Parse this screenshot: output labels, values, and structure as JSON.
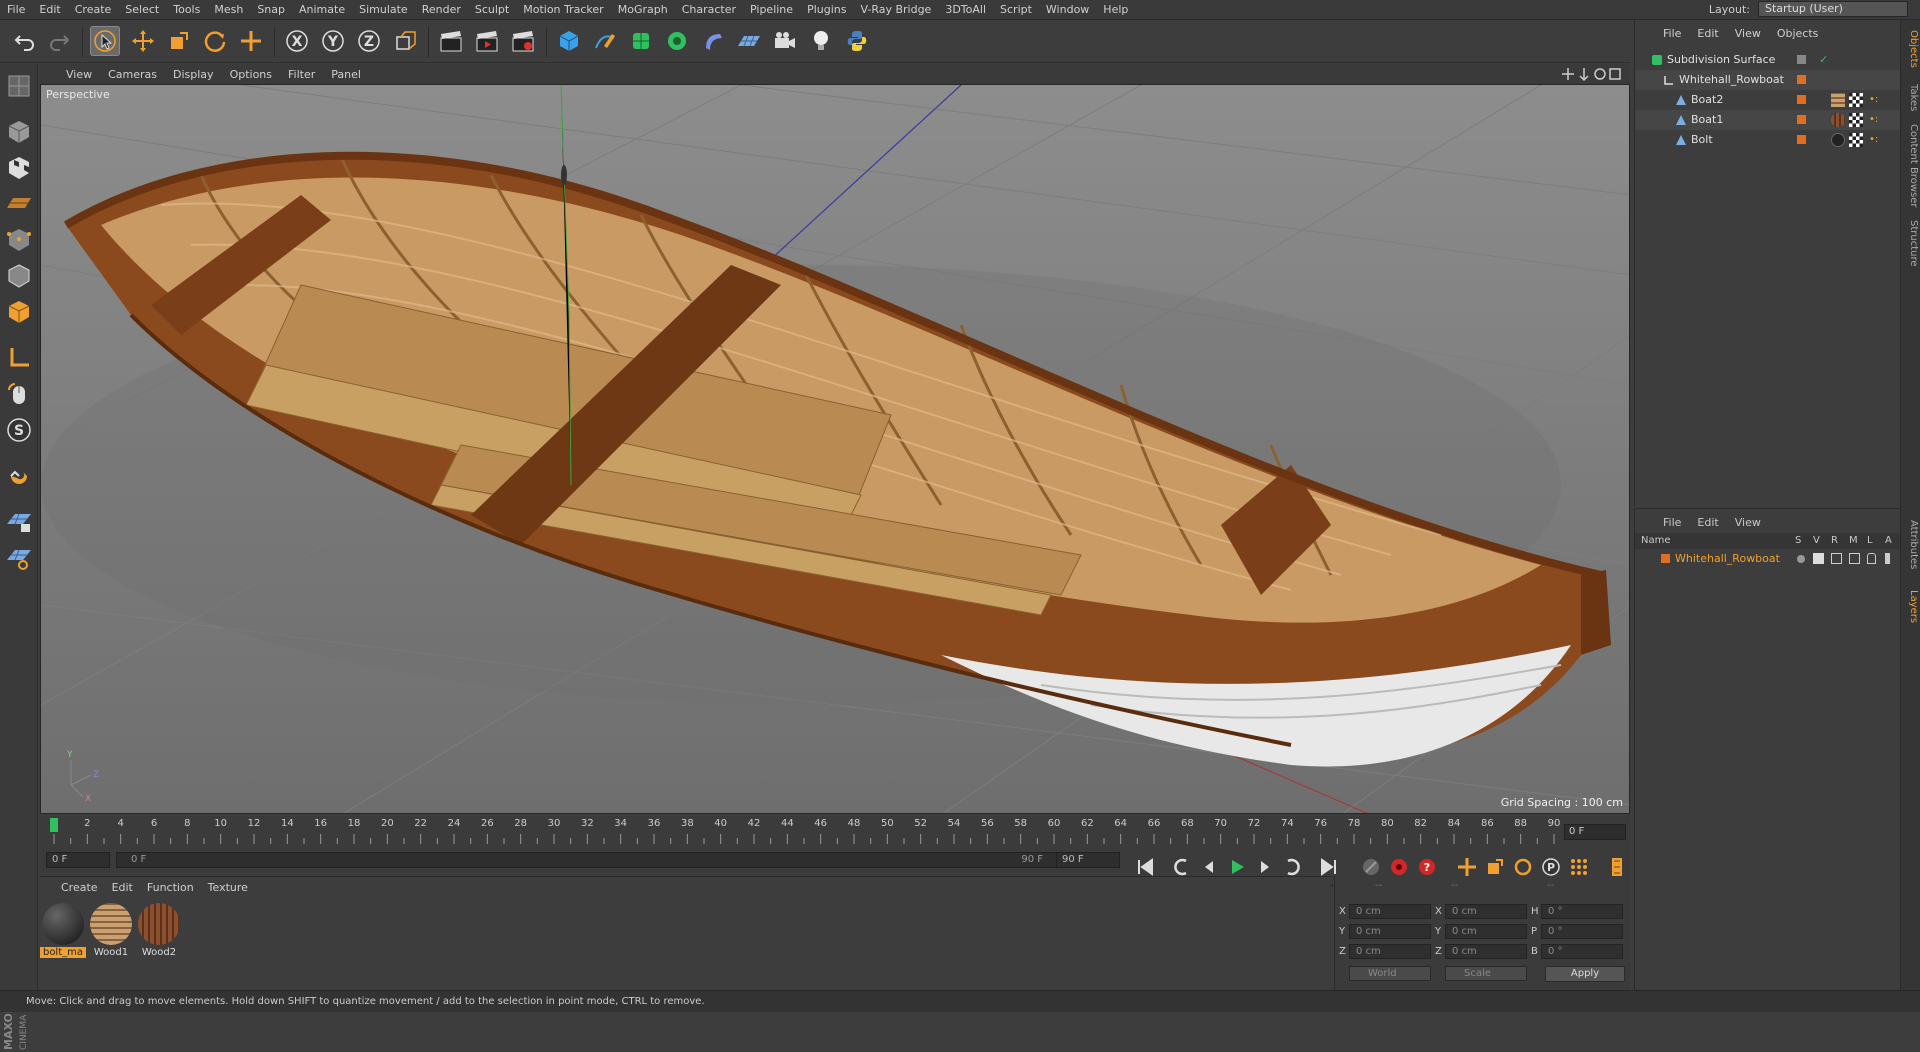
{
  "menu": [
    "File",
    "Edit",
    "Create",
    "Select",
    "Tools",
    "Mesh",
    "Snap",
    "Animate",
    "Simulate",
    "Render",
    "Sculpt",
    "Motion Tracker",
    "MoGraph",
    "Character",
    "Pipeline",
    "Plugins",
    "V-Ray Bridge",
    "3DToAll",
    "Script",
    "Window",
    "Help"
  ],
  "layout": {
    "label": "Layout:",
    "value": "Startup (User)"
  },
  "viewport_menu": [
    "View",
    "Cameras",
    "Display",
    "Options",
    "Filter",
    "Panel"
  ],
  "viewport": {
    "label": "Perspective",
    "grid_spacing": "Grid Spacing : 100 cm"
  },
  "timeline": {
    "ticks": [
      "0",
      "2",
      "4",
      "6",
      "8",
      "10",
      "12",
      "14",
      "16",
      "18",
      "20",
      "22",
      "24",
      "26",
      "28",
      "30",
      "32",
      "34",
      "36",
      "38",
      "40",
      "42",
      "44",
      "46",
      "48",
      "50",
      "52",
      "54",
      "56",
      "58",
      "60",
      "62",
      "64",
      "66",
      "68",
      "70",
      "72",
      "74",
      "76",
      "78",
      "80",
      "82",
      "84",
      "86",
      "88",
      "90"
    ],
    "current": "0 F"
  },
  "transport": {
    "start": "0 F",
    "range_start": "0 F",
    "range_end": "90 F",
    "end": "90 F"
  },
  "materials": {
    "menu": [
      "Create",
      "Edit",
      "Function",
      "Texture"
    ],
    "items": [
      {
        "name": "bolt_ma",
        "selected": true,
        "color": "#2a2a2a"
      },
      {
        "name": "Wood1",
        "selected": false,
        "color": "#b08a60"
      },
      {
        "name": "Wood2",
        "selected": false,
        "color": "#7a4a2a"
      }
    ]
  },
  "coordinates": {
    "headers": [
      "--",
      "--",
      "--"
    ],
    "rows": [
      {
        "a": "X",
        "av": "0 cm",
        "b": "X",
        "bv": "0 cm",
        "c": "H",
        "cv": "0 °"
      },
      {
        "a": "Y",
        "av": "0 cm",
        "b": "Y",
        "bv": "0 cm",
        "c": "P",
        "cv": "0 °"
      },
      {
        "a": "Z",
        "av": "0 cm",
        "b": "Z",
        "bv": "0 cm",
        "c": "B",
        "cv": "0 °"
      }
    ],
    "space": "World",
    "mode": "Scale",
    "apply": "Apply"
  },
  "objects": {
    "menu": [
      "File",
      "Edit",
      "View",
      "Objects"
    ],
    "items": [
      "Subdivision Surface",
      "Whitehall_Rowboat",
      "Boat2",
      "Boat1",
      "Bolt"
    ]
  },
  "layers": {
    "menu": [
      "File",
      "Edit",
      "View"
    ],
    "columns": [
      "Name",
      "S",
      "V",
      "R",
      "M",
      "L",
      "A"
    ],
    "items": [
      "Whitehall_Rowboat"
    ]
  },
  "side_tabs": [
    "Objects",
    "Takes",
    "Content Browser",
    "Structure",
    "Attributes",
    "Layers"
  ],
  "status": "Move: Click and drag to move elements. Hold down SHIFT to quantize movement / add to the selection in point mode, CTRL to remove.",
  "colors": {
    "accent": "#f0a030",
    "layer_orange": "#e07020",
    "text_highlight": "#f0a030"
  }
}
